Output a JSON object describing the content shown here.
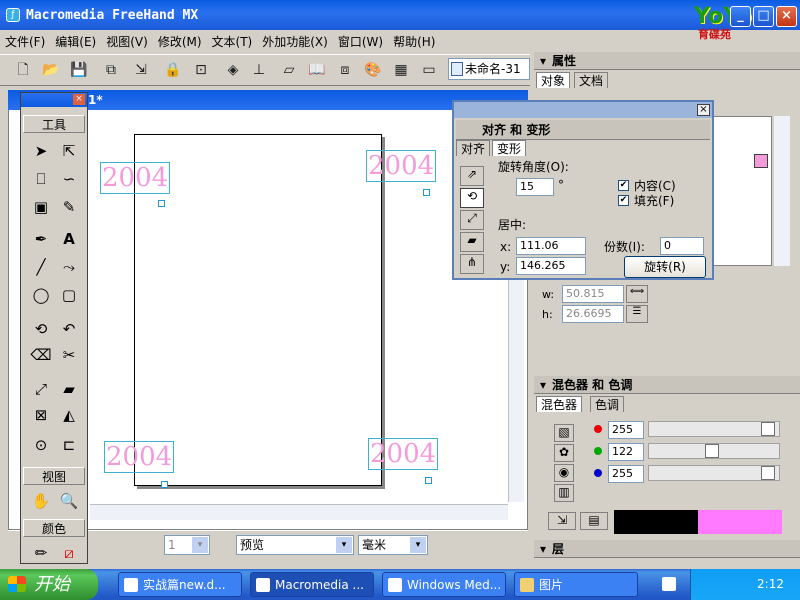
{
  "app": {
    "title": "Macromedia FreeHand MX",
    "logo_text": "YoYo",
    "logo_sub": "育碟苑"
  },
  "menu": [
    "文件(F)",
    "编辑(E)",
    "视图(V)",
    "修改(M)",
    "文本(T)",
    "外加功能(X)",
    "窗口(W)",
    "帮助(H)"
  ],
  "toolbar": {
    "doc_name": "未命名-31"
  },
  "document": {
    "tab_title": "1*",
    "year_text": "2004"
  },
  "tools": {
    "section_tools": "工具",
    "section_view": "视图",
    "section_color": "颜色",
    "icons": [
      "pointer-icon",
      "subselect-icon",
      "lasso-icon",
      "pen-icon",
      "text-icon",
      "line-icon",
      "ellipse-icon",
      "rectangle-icon",
      "knife-icon",
      "eraser-icon",
      "eyedropper-icon",
      "hand-icon",
      "zoom-icon"
    ]
  },
  "status": {
    "page": "1",
    "mode": "预览",
    "unit": "毫米"
  },
  "properties": {
    "title": "属性",
    "tab_object": "对象",
    "tab_document": "文档",
    "w_label": "w:",
    "w_value": "50.815",
    "h_label": "h:",
    "h_value": "26.6695"
  },
  "transform_dialog": {
    "title": "对齐 和 变形",
    "tab_align": "对齐",
    "tab_transform": "变形",
    "rotate_label": "旋转角度(O):",
    "angle": "15",
    "degree": "°",
    "contents_label": "内容(C)",
    "fill_label": "填充(F)",
    "center_label": "居中:",
    "x_label": "x:",
    "x_value": "111.06",
    "y_label": "y:",
    "y_value": "146.265",
    "copies_label": "份数(I):",
    "copies_value": "0",
    "rotate_button": "旋转(R)"
  },
  "mixer": {
    "title": "混色器 和 色调",
    "tab_mixer": "混色器",
    "tab_tint": "色调",
    "r": "255",
    "g": "122",
    "b": "255",
    "r_level": 1.0,
    "g_level": 0.478,
    "b_level": 1.0,
    "colors": {
      "red": "#ee0000",
      "green": "#00aa00",
      "blue": "#0000cc",
      "swatch_black": "#000000",
      "swatch_pink": "#ff7aff"
    }
  },
  "layers": {
    "title": "层"
  },
  "taskbar": {
    "start": "开始",
    "items": [
      "实战篇new.d...",
      "Macromedia ...",
      "Windows Med...",
      "图片"
    ],
    "clock": "2:12"
  }
}
